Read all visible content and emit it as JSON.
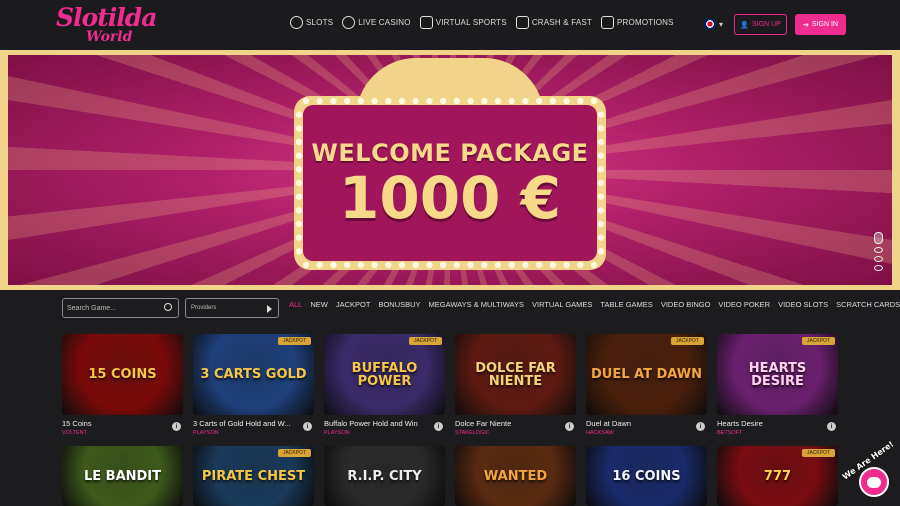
{
  "brand": {
    "line1": "Slotilda",
    "line2": "World"
  },
  "nav": [
    {
      "label": "SLOTS",
      "icon": "slots-icon"
    },
    {
      "label": "LIVE CASINO",
      "icon": "live-casino-icon"
    },
    {
      "label": "VIRTUAL SPORTS",
      "icon": "virtual-sports-icon"
    },
    {
      "label": "CRASH & FAST",
      "icon": "rocket-icon"
    },
    {
      "label": "PROMOTIONS",
      "icon": "gift-icon"
    }
  ],
  "header": {
    "signup_label": "SIGN UP",
    "signin_label": "SIGN IN",
    "language": "en-GB"
  },
  "banner": {
    "title": "WELCOME PACKAGE",
    "amount": "1000 €"
  },
  "search": {
    "placeholder": "Search Game..."
  },
  "providers": {
    "placeholder": "Providers"
  },
  "categories": [
    "ALL",
    "NEW",
    "JACKPOT",
    "BONUSBUY",
    "MEGAWAYS & MULTIWAYS",
    "VIRTUAL GAMES",
    "TABLE GAMES",
    "VIDEO BINGO",
    "VIDEO POKER",
    "VIDEO SLOTS",
    "SCRATCH CARDS"
  ],
  "active_category": "ALL",
  "jackpot_badge": "Jackpot",
  "games_row1": [
    {
      "name": "15 Coins",
      "provider": "VOLTENT",
      "art": "15 COINS",
      "bg": "#7a0a0a",
      "fg": "#f6c744",
      "jackpot": false
    },
    {
      "name": "3 Carts of Gold Hold and W...",
      "provider": "PLAYSON",
      "art": "3 CARTS GOLD",
      "bg": "#1e3f7a",
      "fg": "#f6c744",
      "jackpot": true
    },
    {
      "name": "Buffalo Power Hold and Win",
      "provider": "PLAYSON",
      "art": "BUFFALO POWER",
      "bg": "#3a2a6a",
      "fg": "#f6c744",
      "jackpot": true
    },
    {
      "name": "Dolce Far Niente",
      "provider": "STAKELOGIC",
      "art": "DOLCE FAR NIENTE",
      "bg": "#5e1a12",
      "fg": "#f3d37a",
      "jackpot": false
    },
    {
      "name": "Duel at Dawn",
      "provider": "HACKSAW",
      "art": "DUEL AT DAWN",
      "bg": "#4a1f0c",
      "fg": "#f3a640",
      "jackpot": true
    },
    {
      "name": "Hearts Desire",
      "provider": "BETSOFT",
      "art": "HEARTS DESIRE",
      "bg": "#6a1f6e",
      "fg": "#ffd3ef",
      "jackpot": true
    }
  ],
  "games_row2": [
    {
      "art": "LE BANDIT",
      "bg": "#3e5a1a",
      "fg": "#fff",
      "jackpot": false
    },
    {
      "art": "PIRATE CHEST",
      "bg": "#1a3a5a",
      "fg": "#f6c744",
      "jackpot": true
    },
    {
      "art": "R.I.P. CITY",
      "bg": "#2a2a2a",
      "fg": "#eee",
      "jackpot": false
    },
    {
      "art": "WANTED",
      "bg": "#5a2a10",
      "fg": "#f3a640",
      "jackpot": false
    },
    {
      "art": "16 COINS",
      "bg": "#1a2a6a",
      "fg": "#f6f6ff",
      "jackpot": false
    },
    {
      "art": "777",
      "bg": "#7a0c12",
      "fg": "#ffd34a",
      "jackpot": true
    }
  ],
  "chat": {
    "label": "We Are Here!"
  },
  "colors": {
    "accent": "#ee2d8f",
    "gold": "#f2d38a",
    "background": "#1c1c1e"
  }
}
